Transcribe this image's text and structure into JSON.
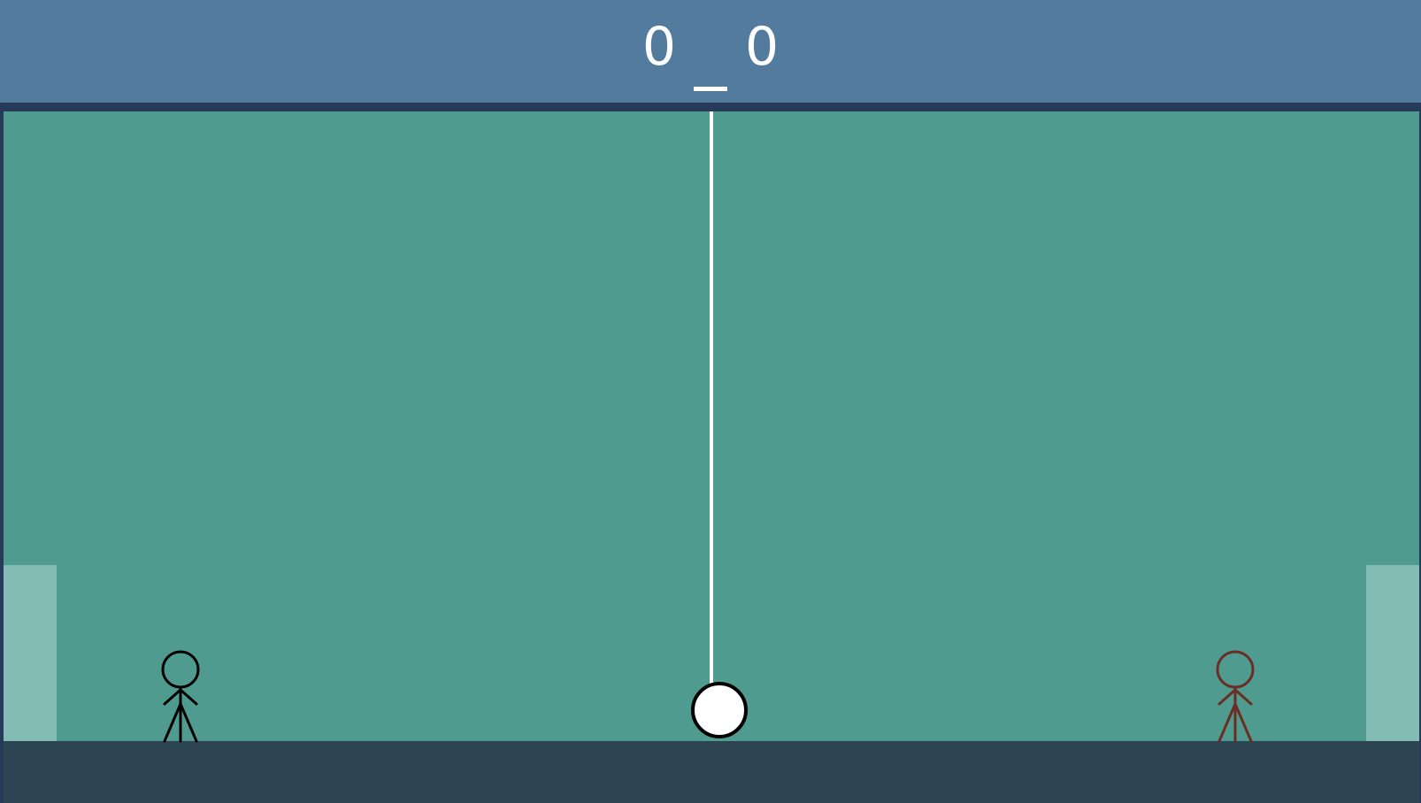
{
  "scoreboard": {
    "left_score": "0",
    "right_score": "0",
    "separator": "–"
  },
  "colors": {
    "scoreboard": "#527b9e",
    "frame": "#263a5a",
    "field": "#4f9b8f",
    "ground": "#2d4552",
    "goal": "#82bcb4",
    "net": "#ffffff",
    "ball": "#ffffff",
    "ball_outline": "#000000",
    "player_left": "#000000",
    "player_right": "#6a2d24"
  },
  "icons": {
    "player_left": "stick-figure-icon",
    "player_right": "stick-figure-icon",
    "ball": "ball-icon"
  }
}
